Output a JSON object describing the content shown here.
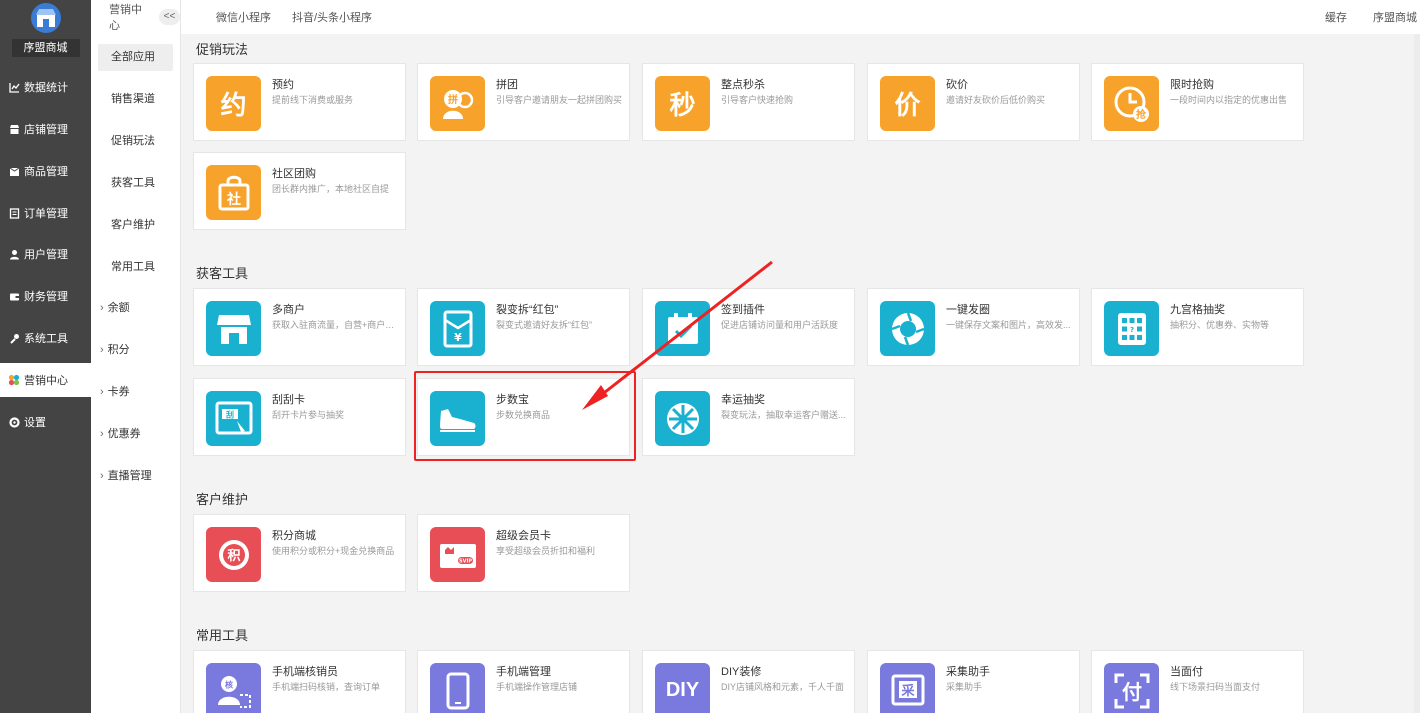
{
  "brand": {
    "name": "序盟商城"
  },
  "sidebar": {
    "items": [
      {
        "label": "数据统计",
        "icon": "chart-icon"
      },
      {
        "label": "店铺管理",
        "icon": "store-icon"
      },
      {
        "label": "商品管理",
        "icon": "goods-icon"
      },
      {
        "label": "订单管理",
        "icon": "order-icon"
      },
      {
        "label": "用户管理",
        "icon": "user-icon"
      },
      {
        "label": "财务管理",
        "icon": "finance-icon"
      },
      {
        "label": "系统工具",
        "icon": "wrench-icon"
      },
      {
        "label": "营销中心",
        "icon": "marketing-icon"
      },
      {
        "label": "设置",
        "icon": "gear-icon"
      }
    ]
  },
  "subnav": {
    "title": "营销中心",
    "collapse": "<<",
    "items": [
      "全部应用",
      "销售渠道",
      "促销玩法",
      "获客工具",
      "客户维护",
      "常用工具"
    ],
    "groups": [
      "余额",
      "积分",
      "卡券",
      "优惠券",
      "直播管理"
    ]
  },
  "topbar": {
    "tabs": [
      "微信小程序",
      "抖音/头条小程序"
    ],
    "right": [
      "缓存",
      "序盟商城"
    ]
  },
  "sections": [
    {
      "title": "促销玩法"
    },
    {
      "title": "获客工具"
    },
    {
      "title": "客户维护"
    },
    {
      "title": "常用工具"
    }
  ],
  "cards": [
    {
      "title": "预约",
      "desc": "提前线下消费或服务",
      "glyph": "约"
    },
    {
      "title": "拼团",
      "desc": "引导客户邀请朋友一起拼团购买",
      "glyph": "拼"
    },
    {
      "title": "整点秒杀",
      "desc": "引导客户快速抢购",
      "glyph": "秒"
    },
    {
      "title": "砍价",
      "desc": "邀请好友砍价后低价购买",
      "glyph": "价"
    },
    {
      "title": "限时抢购",
      "desc": "一段时间内以指定的优惠出售",
      "glyph": "抢"
    },
    {
      "title": "社区团购",
      "desc": "团长群内推广，本地社区自提",
      "glyph": "社"
    },
    {
      "title": "多商户",
      "desc": "获取入驻商流量，自营+商户入...",
      "glyph": ""
    },
    {
      "title": "裂变拆“红包”",
      "desc": "裂变式邀请好友拆“红包”",
      "glyph": "¥"
    },
    {
      "title": "签到插件",
      "desc": "促进店铺访问量和用户活跃度",
      "glyph": ""
    },
    {
      "title": "一键发圈",
      "desc": "一键保存文案和图片，高效发...",
      "glyph": ""
    },
    {
      "title": "九宫格抽奖",
      "desc": "抽积分、优惠券、实物等",
      "glyph": ""
    },
    {
      "title": "刮刮卡",
      "desc": "刮开卡片参与抽奖",
      "glyph": "刮"
    },
    {
      "title": "步数宝",
      "desc": "步数兑换商品",
      "glyph": ""
    },
    {
      "title": "幸运抽奖",
      "desc": "裂变玩法，抽取幸运客户赠送...",
      "glyph": ""
    },
    {
      "title": "积分商城",
      "desc": "使用积分或积分+现金兑换商品",
      "glyph": "积"
    },
    {
      "title": "超级会员卡",
      "desc": "享受超级会员折扣和福利",
      "glyph": "SVIP"
    },
    {
      "title": "手机端核销员",
      "desc": "手机端扫码核销，查询订单",
      "glyph": "核"
    },
    {
      "title": "手机端管理",
      "desc": "手机端操作管理店铺",
      "glyph": ""
    },
    {
      "title": "DIY装修",
      "desc": "DIY店铺风格和元素，千人千面",
      "glyph": "DIY"
    },
    {
      "title": "采集助手",
      "desc": "采集助手",
      "glyph": "采"
    },
    {
      "title": "当面付",
      "desc": "线下场景扫码当面支付",
      "glyph": "付"
    }
  ]
}
